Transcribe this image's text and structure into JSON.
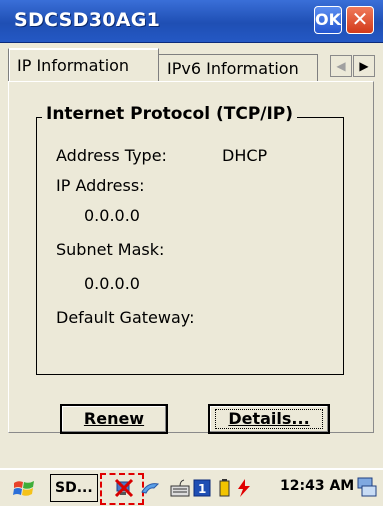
{
  "window": {
    "title": "SDCSD30AG1",
    "ok_label": "OK",
    "close_label": "✕"
  },
  "tabs": [
    {
      "label": "IP Information",
      "selected": true
    },
    {
      "label": "IPv6 Information",
      "selected": false
    }
  ],
  "tab_scroll": {
    "left": "◀",
    "right": "▶"
  },
  "group": {
    "title": "Internet Protocol (TCP/IP)",
    "address_type_label": "Address Type:",
    "address_type_value": "DHCP",
    "ip_label": "IP Address:",
    "ip_value": "0.0.0.0",
    "subnet_label": "Subnet Mask:",
    "subnet_value": "0.0.0.0",
    "gateway_label": "Default Gateway:",
    "gateway_value": ""
  },
  "buttons": {
    "renew_label": "Renew",
    "details_label": "Details..."
  },
  "taskbar": {
    "task_label": "SD...",
    "clock": "12:43 AM"
  },
  "icons": [
    "windows-start-icon",
    "network-disconnected-icon",
    "bluetooth-icon",
    "keyboard-icon",
    "input-panel-icon",
    "battery-icon",
    "power-icon",
    "desktop-icon"
  ]
}
